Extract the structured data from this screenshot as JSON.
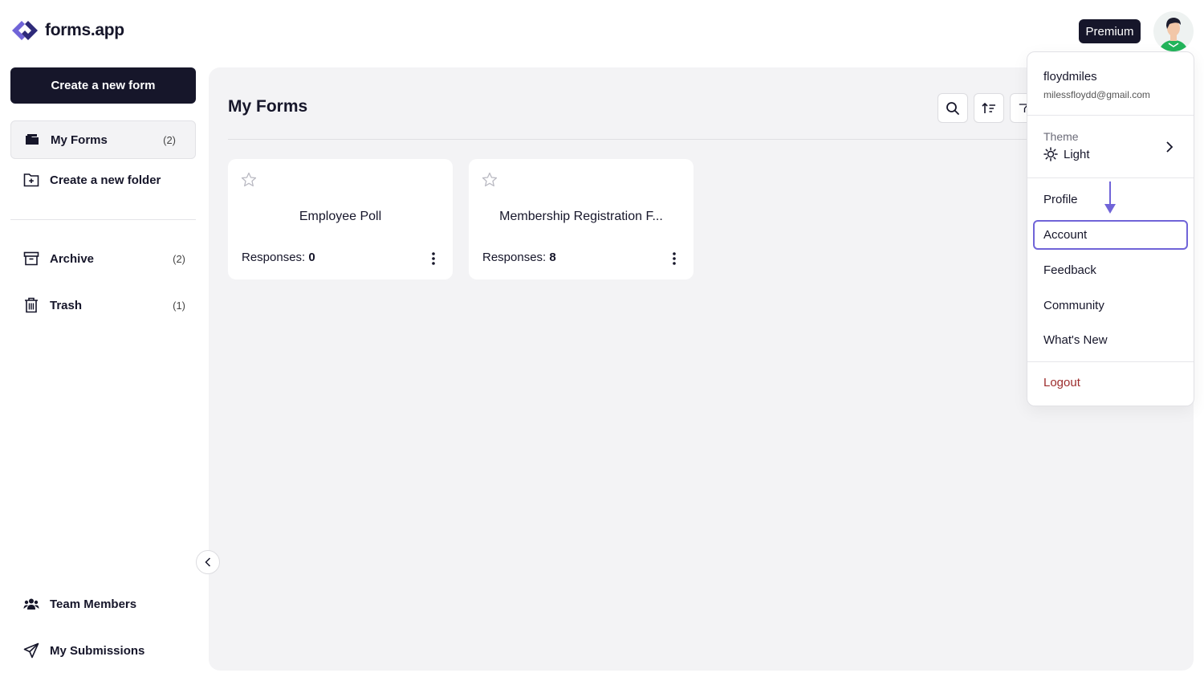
{
  "app": {
    "name": "forms.app",
    "accent": "#7064d8"
  },
  "header": {
    "premium_label": "Premium",
    "avatar_icon": "user-avatar"
  },
  "sidebar": {
    "create_label": "Create a new form",
    "items": [
      {
        "label": "My Forms",
        "count": "(2)",
        "icon": "folder-icon"
      },
      {
        "label": "Create a new folder",
        "icon": "folder-plus-icon"
      },
      {
        "label": "Archive",
        "count": "(2)",
        "icon": "archive-icon"
      },
      {
        "label": "Trash",
        "count": "(1)",
        "icon": "trash-icon"
      },
      {
        "label": "Team Members",
        "icon": "team-icon"
      },
      {
        "label": "My Submissions",
        "icon": "send-icon"
      }
    ]
  },
  "main": {
    "title": "My Forms",
    "forms": [
      {
        "title": "Employee Poll",
        "responses_label": "Responses:",
        "responses": "0"
      },
      {
        "title": "Membership Registration F...",
        "responses_label": "Responses:",
        "responses": "8"
      }
    ]
  },
  "dropdown": {
    "username": "floydmiles",
    "email": "milessfloydd@gmail.com",
    "theme_label": "Theme",
    "theme_value": "Light",
    "items": [
      "Profile",
      "Account",
      "Feedback",
      "Community",
      "What's New"
    ],
    "selected": "Account",
    "logout_label": "Logout"
  }
}
